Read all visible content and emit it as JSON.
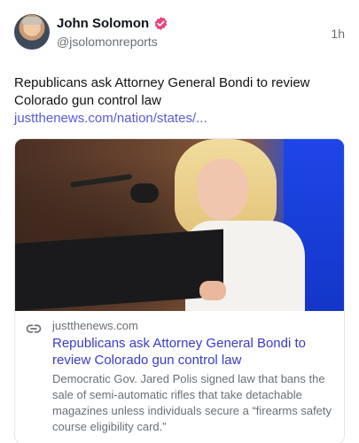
{
  "author": {
    "display_name": "John Solomon",
    "handle": "@jsolomonreports",
    "verified_color": "#e8457a"
  },
  "post": {
    "timestamp": "1h",
    "text": "Republicans ask Attorney General Bondi to review Colorado gun control law ",
    "link_text": "justthenews.com/nation/states/..."
  },
  "card": {
    "domain": "justthenews.com",
    "title": "Republicans ask Attorney General Bondi to review Colorado gun control law",
    "description": "Democratic Gov. Jared Polis signed law that bans the sale of semi-automatic rifles that take detachable magazines unless individuals secure a “firearms safety course eligibility card.”",
    "icon": "link-icon"
  },
  "colors": {
    "link": "#5a5ad6",
    "card_title": "#3a3ac8",
    "muted": "#6a6f75"
  }
}
